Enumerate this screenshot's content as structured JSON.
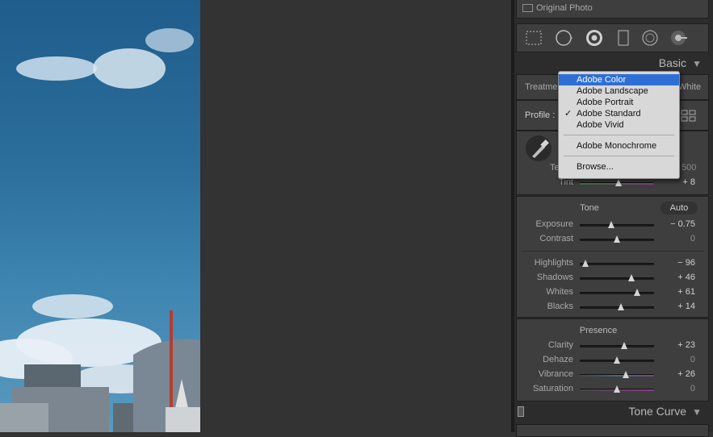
{
  "panel": {
    "original_photo": "Original Photo",
    "basic": "Basic",
    "treatment_label": "Treatme",
    "treatment_right": "White",
    "profile_label": "Profile :",
    "temp_label": "Te",
    "temp_value": "500",
    "tint_label": "Tint",
    "tint_value": "+ 8",
    "tone_title": "Tone",
    "auto_label": "Auto",
    "presence_title": "Presence",
    "tone_curve": "Tone Curve"
  },
  "sliders": {
    "exposure": {
      "label": "Exposure",
      "value": "− 0.75",
      "level": 0.42
    },
    "contrast": {
      "label": "Contrast",
      "value": "0",
      "level": 0.5
    },
    "highlights": {
      "label": "Highlights",
      "value": "− 96",
      "level": 0.08
    },
    "shadows": {
      "label": "Shadows",
      "value": "+ 46",
      "level": 0.7
    },
    "whites": {
      "label": "Whites",
      "value": "+ 61",
      "level": 0.77
    },
    "blacks": {
      "label": "Blacks",
      "value": "+ 14",
      "level": 0.55
    },
    "clarity": {
      "label": "Clarity",
      "value": "+ 23",
      "level": 0.6
    },
    "dehaze": {
      "label": "Dehaze",
      "value": "0",
      "level": 0.5
    },
    "vibrance": {
      "label": "Vibrance",
      "value": "+ 26",
      "level": 0.62
    },
    "saturation": {
      "label": "Saturation",
      "value": "0",
      "level": 0.5
    },
    "tint": {
      "label": "Tint",
      "value": "+ 8",
      "level": 0.52
    }
  },
  "menu": {
    "items": [
      "Adobe Color",
      "Adobe Landscape",
      "Adobe Portrait",
      "Adobe Standard",
      "Adobe Vivid"
    ],
    "monochrome": "Adobe Monochrome",
    "browse": "Browse...",
    "checked_item": "Adobe Standard",
    "highlighted_item": "Adobe Color",
    "check_glyph": "✓"
  },
  "colors": {
    "highlight": "#2e6fd6",
    "panel_bg": "#2c2c2c",
    "section_bg": "#3e3e3e"
  },
  "icons": [
    "crop-overlay-icon",
    "spot-removal-icon",
    "red-eye-icon",
    "graduated-filter-icon",
    "radial-filter-icon",
    "adjustment-brush-icon",
    "panel-collapse-triangle-icon",
    "eyedropper-icon",
    "profile-browser-grid-icon"
  ]
}
